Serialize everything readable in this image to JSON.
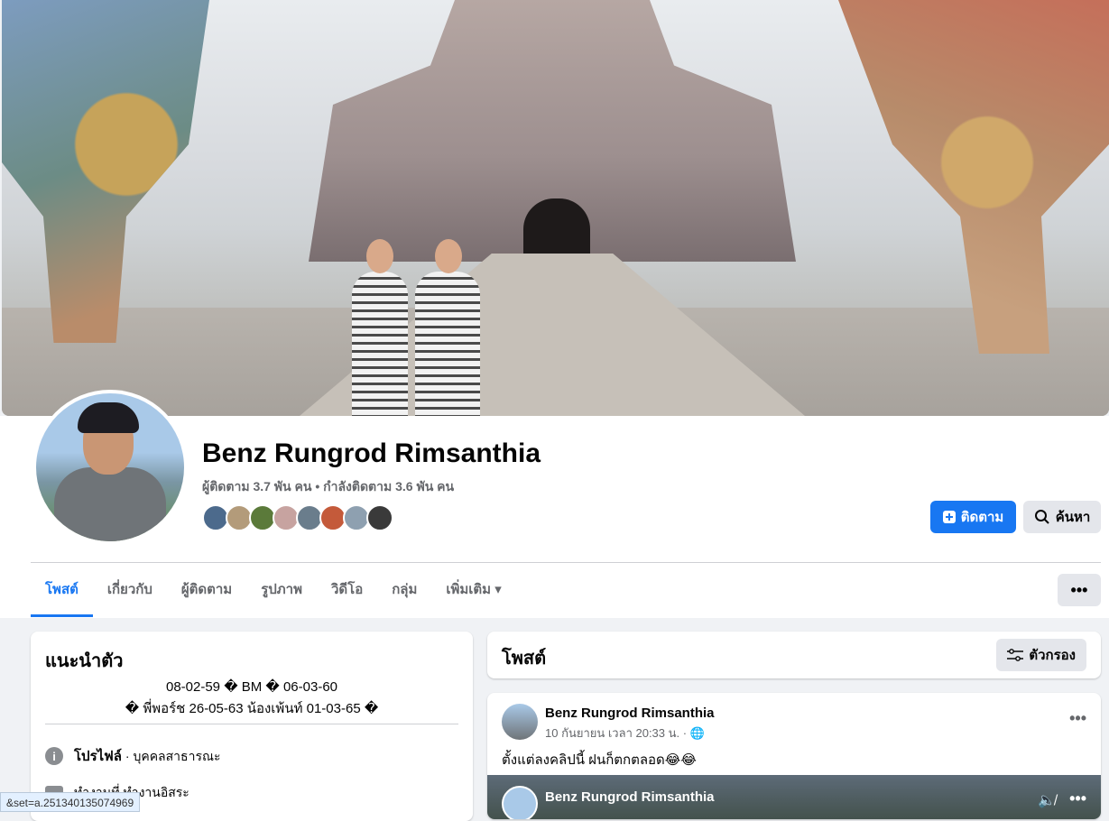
{
  "profile": {
    "name": "Benz Rungrod Rimsanthia",
    "follow_info": "ผู้ติดตาม 3.7 พัน คน • กำลังติดตาม 3.6 พัน คน",
    "friend_colors": [
      "#4c6a8c",
      "#b39b7a",
      "#5b7a3a",
      "#c7a3a0",
      "#6a7d8c",
      "#c45a3a",
      "#8ea0b0",
      "#3a3a3a"
    ]
  },
  "actions": {
    "follow_label": "ติดตาม",
    "search_label": "ค้นหา",
    "more_label": "•••"
  },
  "tabs": [
    {
      "label": "โพสต์"
    },
    {
      "label": "เกี่ยวกับ"
    },
    {
      "label": "ผู้ติดตาม"
    },
    {
      "label": "รูปภาพ"
    },
    {
      "label": "วิดีโอ"
    },
    {
      "label": "กลุ่ม"
    },
    {
      "label": "เพิ่มเติม ▾"
    }
  ],
  "intro": {
    "title": "แนะนำตัว",
    "bio_line1": "08-02-59 � BM � 06-03-60",
    "bio_line2": "� พี่พอร์ช 26-05-63 น้องเพ้นท์ 01-03-65 �",
    "profile_label": "โปรไฟล์",
    "profile_value": " · บุคคลสาธารณะ",
    "work_text": "ทำงานที่ ทำงานอิสระ"
  },
  "posts": {
    "title": "โพสต์",
    "filter_label": "ตัวกรอง"
  },
  "post": {
    "author": "Benz Rungrod Rimsanthia",
    "time": "10 กันยายน เวลา 20:33 น. · 🌐",
    "text": "ตั้งแต่ลงคลิปนี้ ฝนก็ตกตลอด😂😂",
    "video_author": "Benz Rungrod Rimsanthia"
  },
  "status_bar": "&set=a.251340135074969"
}
